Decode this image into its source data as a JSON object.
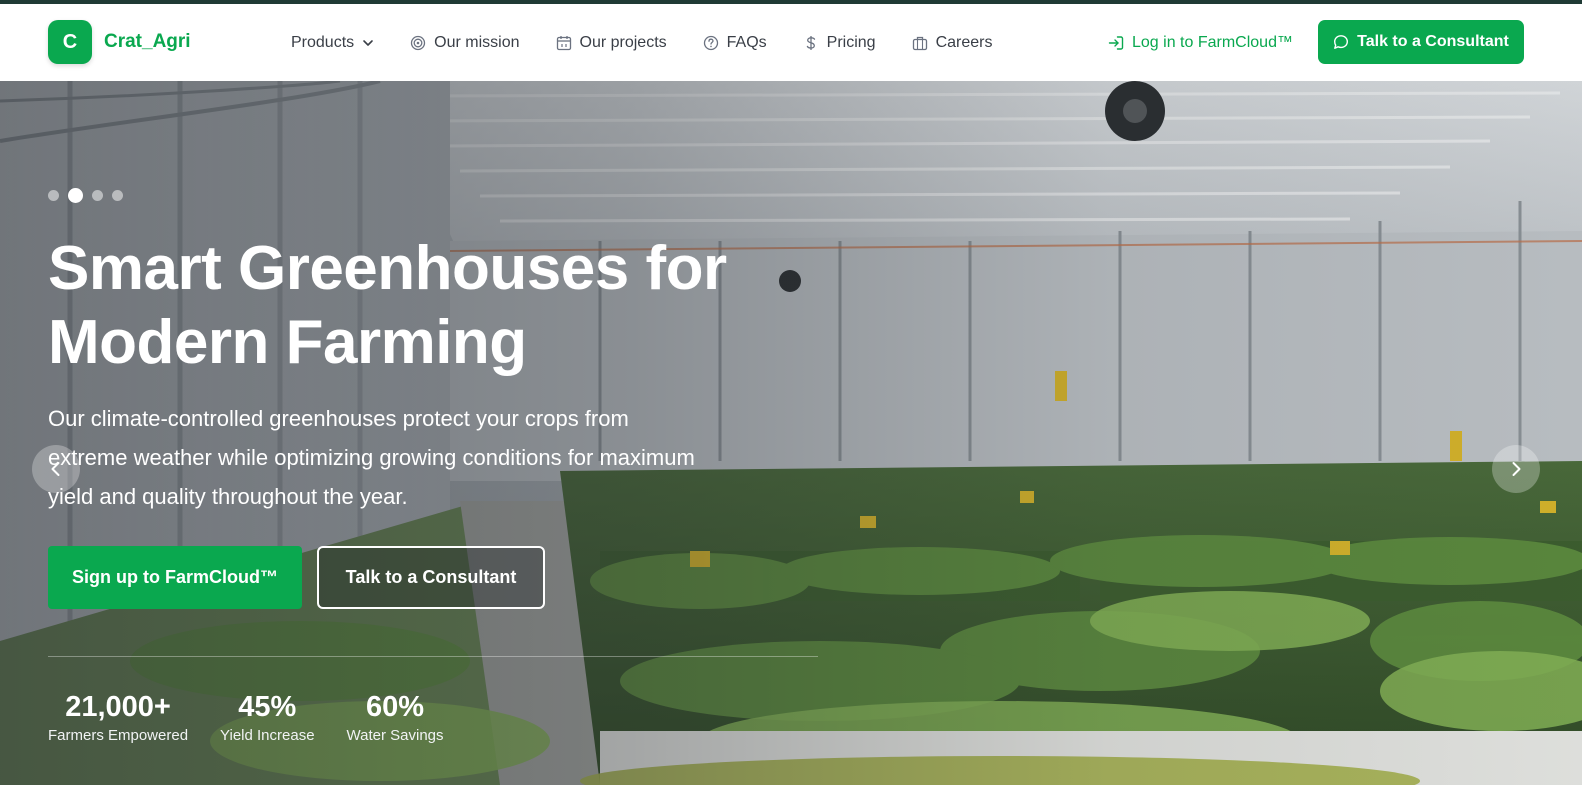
{
  "brand": {
    "logo_letter": "C",
    "name": "Crat_Agri",
    "accent": "#0aa84f"
  },
  "nav": {
    "items": [
      {
        "label": "Products",
        "icon": "chevron-down-icon"
      },
      {
        "label": "Our mission",
        "icon": "target-icon"
      },
      {
        "label": "Our projects",
        "icon": "calendar-icon"
      },
      {
        "label": "FAQs",
        "icon": "question-circle-icon"
      },
      {
        "label": "Pricing",
        "icon": "dollar-icon"
      },
      {
        "label": "Careers",
        "icon": "briefcase-icon"
      }
    ],
    "login_label": "Log in to FarmCloud™",
    "consult_label": "Talk to a Consultant"
  },
  "hero": {
    "title_line1": "Smart Greenhouses for",
    "title_line2": "Modern Farming",
    "description": "Our climate-controlled greenhouses protect your crops from extreme weather while optimizing growing conditions for maximum yield and quality throughout the year.",
    "primary_cta": "Sign up to FarmCloud™",
    "secondary_cta": "Talk to a Consultant",
    "slides_count": 4,
    "active_slide": 2,
    "stats": [
      {
        "value": "21,000+",
        "label": "Farmers Empowered"
      },
      {
        "value": "45%",
        "label": "Yield Increase"
      },
      {
        "value": "60%",
        "label": "Water Savings"
      }
    ]
  }
}
